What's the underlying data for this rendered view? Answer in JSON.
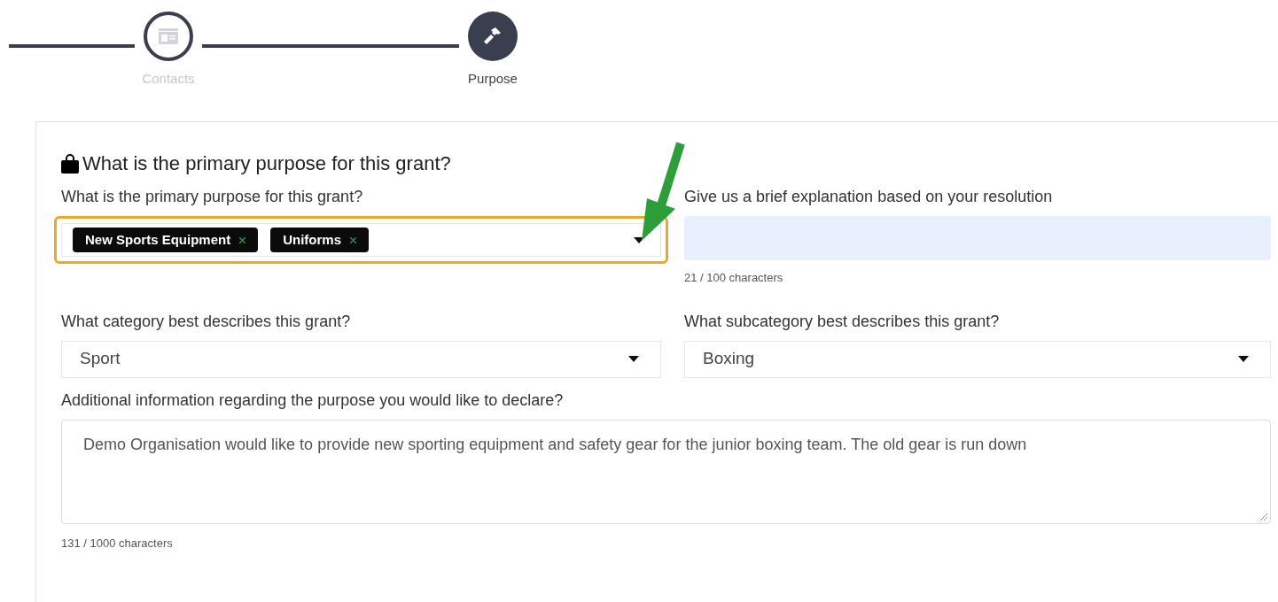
{
  "steps": [
    {
      "label": "Contacts",
      "kind": "contact",
      "selected": false
    },
    {
      "label": "Purpose",
      "kind": "hammer",
      "selected": true
    }
  ],
  "section": {
    "title": "What is the primary purpose for this grant?"
  },
  "purpose": {
    "label": "What is the primary purpose for this grant?",
    "tags": [
      "New Sports Equipment",
      "Uniforms"
    ],
    "highlighted": true
  },
  "explanation": {
    "label": "Give us a brief explanation based on your resolution",
    "counter": "21 / 100 characters"
  },
  "category": {
    "label": "What category best describes this grant?",
    "value": "Sport"
  },
  "subcategory": {
    "label": "What subcategory best describes this grant?",
    "value": "Boxing"
  },
  "additional": {
    "label": "Additional information regarding the purpose you would like to declare?",
    "value": "Demo Organisation would like to provide new sporting equipment and safety gear for the junior boxing team. The old gear is run down",
    "counter": "131 / 1000 characters"
  }
}
